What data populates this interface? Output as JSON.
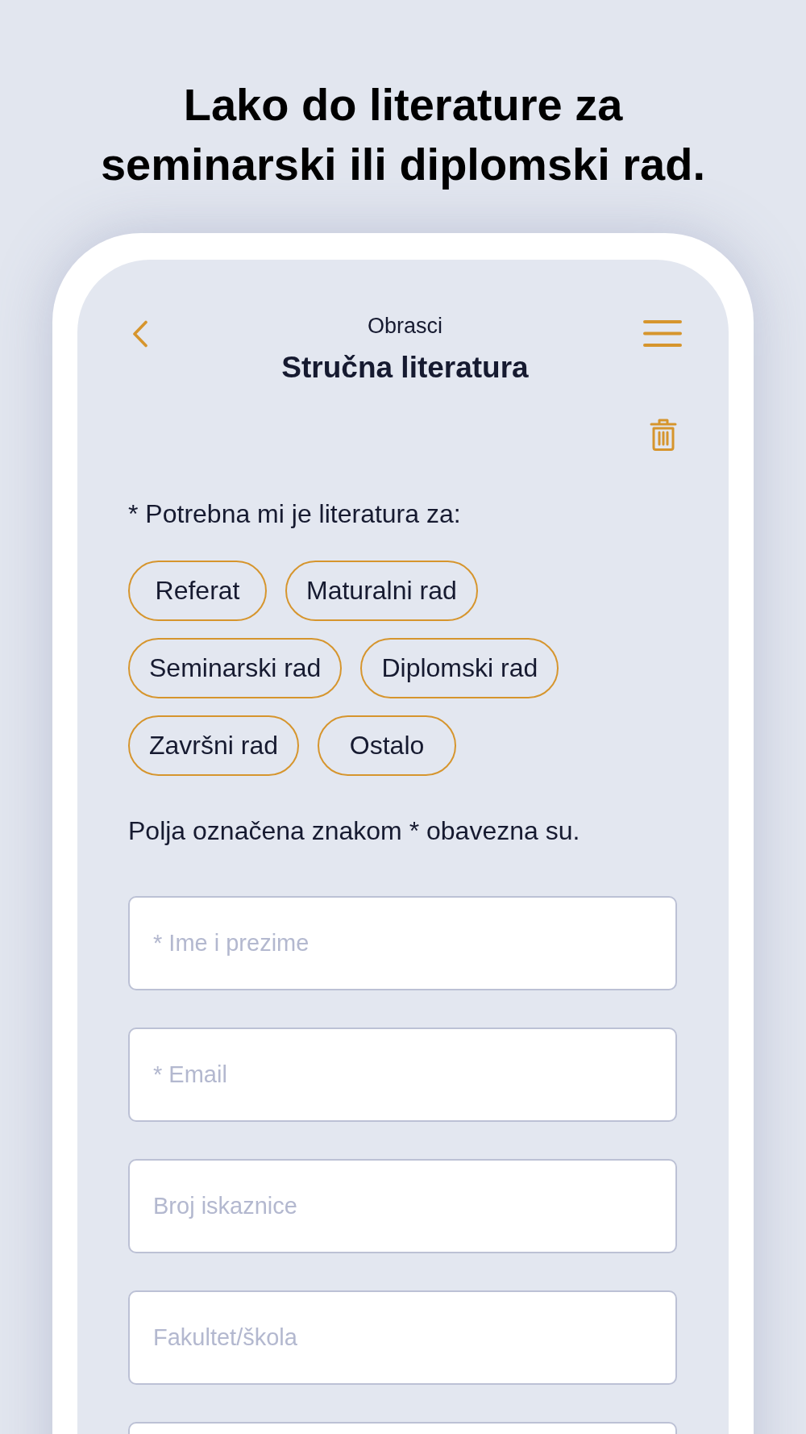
{
  "headline": "Lako do literature za seminarski ili diplomski rad.",
  "nav": {
    "section": "Obrasci",
    "title": "Stručna literatura"
  },
  "purpose": {
    "label": "* Potrebna mi je literatura za:",
    "options": [
      {
        "label": "Referat",
        "selected": false
      },
      {
        "label": "Maturalni rad",
        "selected": false
      },
      {
        "label": "Seminarski rad",
        "selected": false
      },
      {
        "label": "Diplomski rad",
        "selected": false
      },
      {
        "label": "Završni rad",
        "selected": false
      },
      {
        "label": "Ostalo",
        "selected": false
      }
    ]
  },
  "required_note": "Polja označena znakom * obavezna su.",
  "fields": [
    {
      "placeholder": "* Ime i prezime"
    },
    {
      "placeholder": "* Email"
    },
    {
      "placeholder": "Broj iskaznice"
    },
    {
      "placeholder": "Fakultet/škola"
    }
  ],
  "next_field_cut_off": true
}
